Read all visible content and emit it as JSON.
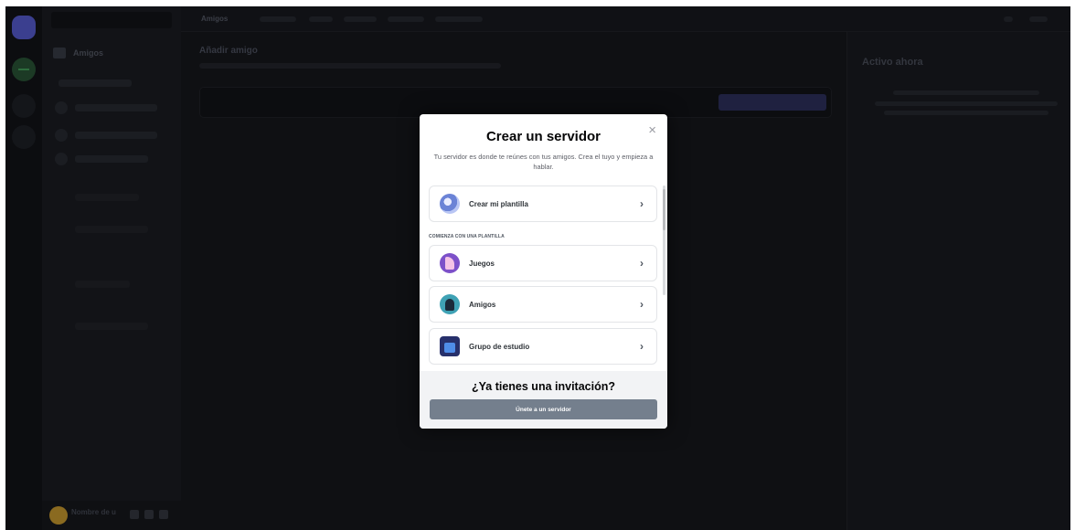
{
  "background": {
    "topbar_active_tab": "Amigos",
    "main_heading": "Añadir amigo",
    "right_panel_title": "Activo ahora",
    "sidebar_friends_label": "Amigos",
    "user_name": "Nombre de u"
  },
  "modal": {
    "title": "Crear un servidor",
    "subtitle": "Tu servidor es donde te reúnes con tus amigos. Crea el tuyo y empieza a hablar.",
    "close_icon": "×",
    "own_template": {
      "label": "Crear mi plantilla",
      "icon": "globe-icon"
    },
    "section_label": "COMIENZA CON UNA PLANTILLA",
    "templates": [
      {
        "label": "Juegos",
        "icon": "game-controller-icon"
      },
      {
        "label": "Amigos",
        "icon": "friends-icon"
      },
      {
        "label": "Grupo de estudio",
        "icon": "study-group-icon"
      }
    ],
    "chevron": "›",
    "footer_title": "¿Ya tienes una invitación?",
    "join_button": "Únete a un servidor"
  },
  "colors": {
    "overlay_bg": "#0f1013",
    "modal_bg": "#ffffff",
    "footer_bg": "#f2f3f5",
    "join_button_bg": "#747f8d"
  }
}
